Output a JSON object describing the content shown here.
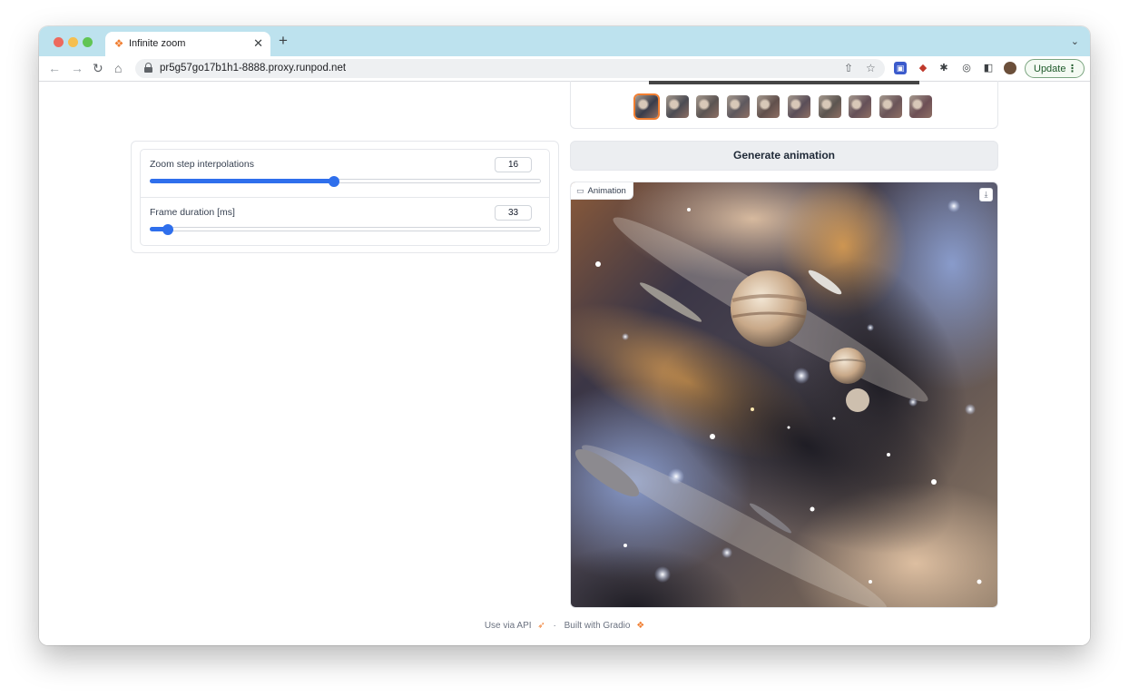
{
  "browser": {
    "tab_title": "Infinite zoom",
    "url": "pr5g57go17b1h1-8888.proxy.runpod.net",
    "update_label": "Update",
    "icons": [
      "arrow-left-icon",
      "arrow-right-icon",
      "reload-icon",
      "home-icon",
      "lock-icon",
      "share-icon",
      "star-icon",
      "bitwarden-icon",
      "extension-badge-icon",
      "puzzle-icon",
      "clipboard-icon",
      "sidepanel-icon",
      "avatar-icon",
      "kebab-menu-icon"
    ]
  },
  "gallery": {
    "thumb_count": 10,
    "selected_index": 0
  },
  "generate": {
    "label": "Generate animation"
  },
  "sliders": [
    {
      "label": "Zoom step interpolations",
      "value": "16",
      "fraction": 0.47
    },
    {
      "label": "Frame duration [ms]",
      "value": "33",
      "fraction": 0.045
    }
  ],
  "animation": {
    "badge_label": "Animation"
  },
  "footer": {
    "api_label": "Use via API",
    "separator": "·",
    "built_label": "Built with Gradio"
  },
  "colors": {
    "accent": "#2f6fec",
    "gradio_orange": "#f07d30",
    "tabbar": "#bde2ee"
  }
}
